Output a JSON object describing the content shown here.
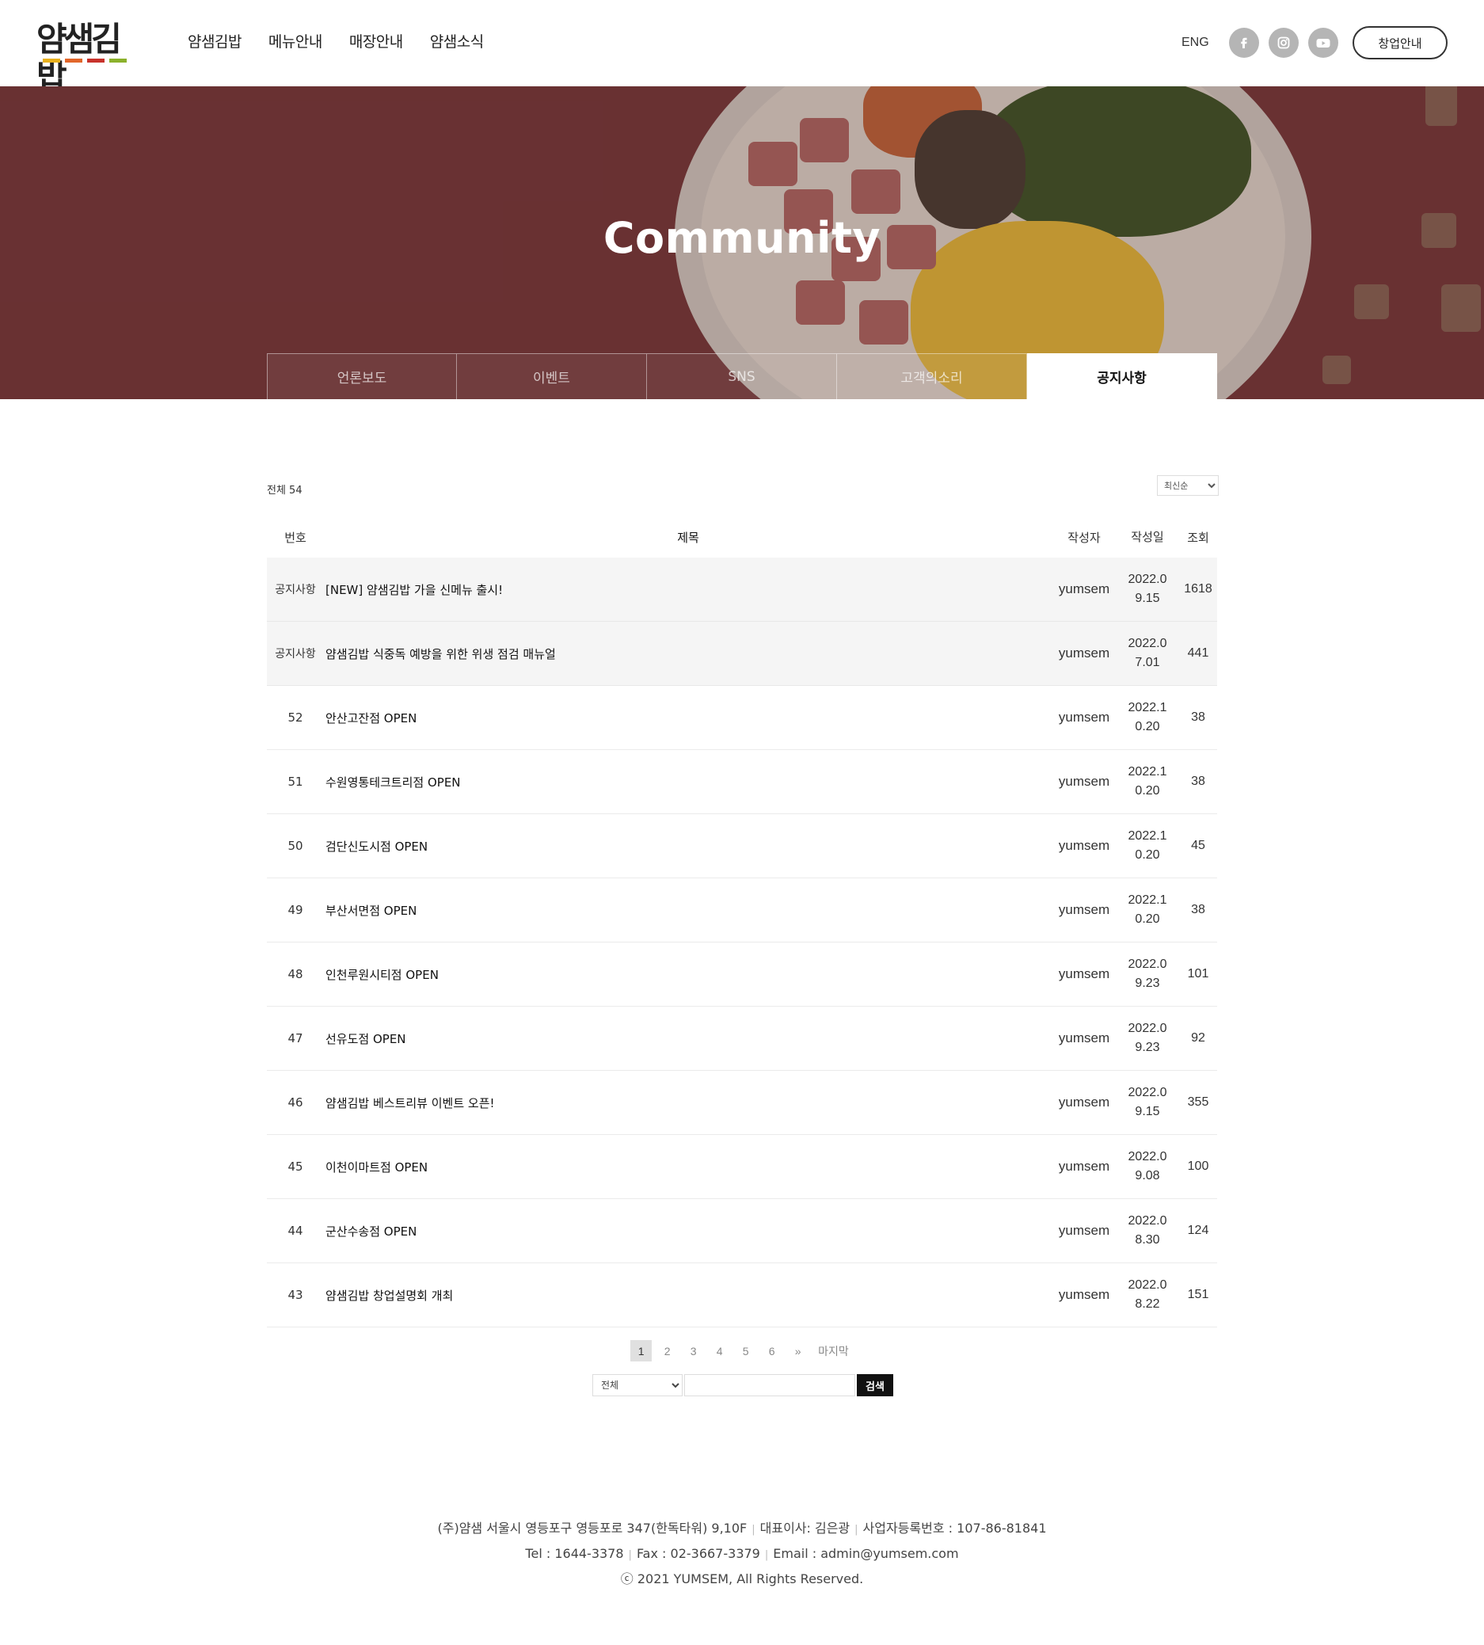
{
  "header": {
    "logo": "얌샘김밥",
    "nav": [
      "얌샘김밥",
      "메뉴안내",
      "매장안내",
      "얌샘소식"
    ],
    "lang": "ENG",
    "sns": [
      "facebook-icon",
      "instagram-icon",
      "youtube-icon"
    ],
    "startup_label": "창업안내"
  },
  "hero": {
    "title": "Community",
    "tabs": [
      "언론보도",
      "이벤트",
      "SNS",
      "고객의소리",
      "공지사항"
    ],
    "active_tab": "공지사항"
  },
  "board": {
    "total": "전체 54",
    "sort_selected": "최신순",
    "columns": {
      "no": "번호",
      "title": "제목",
      "writer": "작성자",
      "date": "작성일",
      "views": "조회"
    },
    "rows": [
      {
        "no": "공지사항",
        "title": "[NEW] 얌샘김밥 가을 신메뉴 출시!",
        "writer": "yumsem",
        "date": "2022.09.15",
        "views": "1618",
        "notice": true
      },
      {
        "no": "공지사항",
        "title": "얌샘김밥 식중독 예방을 위한 위생 점검 매뉴얼",
        "writer": "yumsem",
        "date": "2022.07.01",
        "views": "441",
        "notice": true
      },
      {
        "no": "52",
        "title": "안산고잔점 OPEN",
        "writer": "yumsem",
        "date": "2022.10.20",
        "views": "38"
      },
      {
        "no": "51",
        "title": "수원영통테크트리점 OPEN",
        "writer": "yumsem",
        "date": "2022.10.20",
        "views": "38"
      },
      {
        "no": "50",
        "title": "검단신도시점 OPEN",
        "writer": "yumsem",
        "date": "2022.10.20",
        "views": "45"
      },
      {
        "no": "49",
        "title": "부산서면점 OPEN",
        "writer": "yumsem",
        "date": "2022.10.20",
        "views": "38"
      },
      {
        "no": "48",
        "title": "인천루원시티점 OPEN",
        "writer": "yumsem",
        "date": "2022.09.23",
        "views": "101"
      },
      {
        "no": "47",
        "title": "선유도점 OPEN",
        "writer": "yumsem",
        "date": "2022.09.23",
        "views": "92"
      },
      {
        "no": "46",
        "title": "얌샘김밥 베스트리뷰 이벤트 오픈!",
        "writer": "yumsem",
        "date": "2022.09.15",
        "views": "355"
      },
      {
        "no": "45",
        "title": "이천이마트점 OPEN",
        "writer": "yumsem",
        "date": "2022.09.08",
        "views": "100"
      },
      {
        "no": "44",
        "title": "군산수송점 OPEN",
        "writer": "yumsem",
        "date": "2022.08.30",
        "views": "124"
      },
      {
        "no": "43",
        "title": "얌샘김밥 창업설명회 개최",
        "writer": "yumsem",
        "date": "2022.08.22",
        "views": "151"
      }
    ],
    "pages": [
      "1",
      "2",
      "3",
      "4",
      "5",
      "6",
      "»",
      "마지막"
    ],
    "current_page": "1",
    "search": {
      "select": "전체",
      "button": "검색",
      "value": ""
    }
  },
  "footer": {
    "company": "(주)얌샘 서울시 영등포구 영등포로 347(한독타워) 9,10F",
    "ceo": "대표이사: 김은광",
    "bizno": "사업자등록번호 : 107-86-81841",
    "tel": "Tel : 1644-3378",
    "fax": "Fax : 02-3667-3379",
    "email": "Email : admin@yumsem.com",
    "copyright": "ⓒ 2021 YUMSEM, All Rights Reserved."
  },
  "colors": {
    "hero_bg": "#7a3c3e",
    "logo_bar_yellow": "#e8b01c",
    "logo_bar_orange": "#e2662a",
    "logo_bar_red": "#c8322b",
    "logo_bar_green": "#8bb12b",
    "search_button": "#111111"
  }
}
